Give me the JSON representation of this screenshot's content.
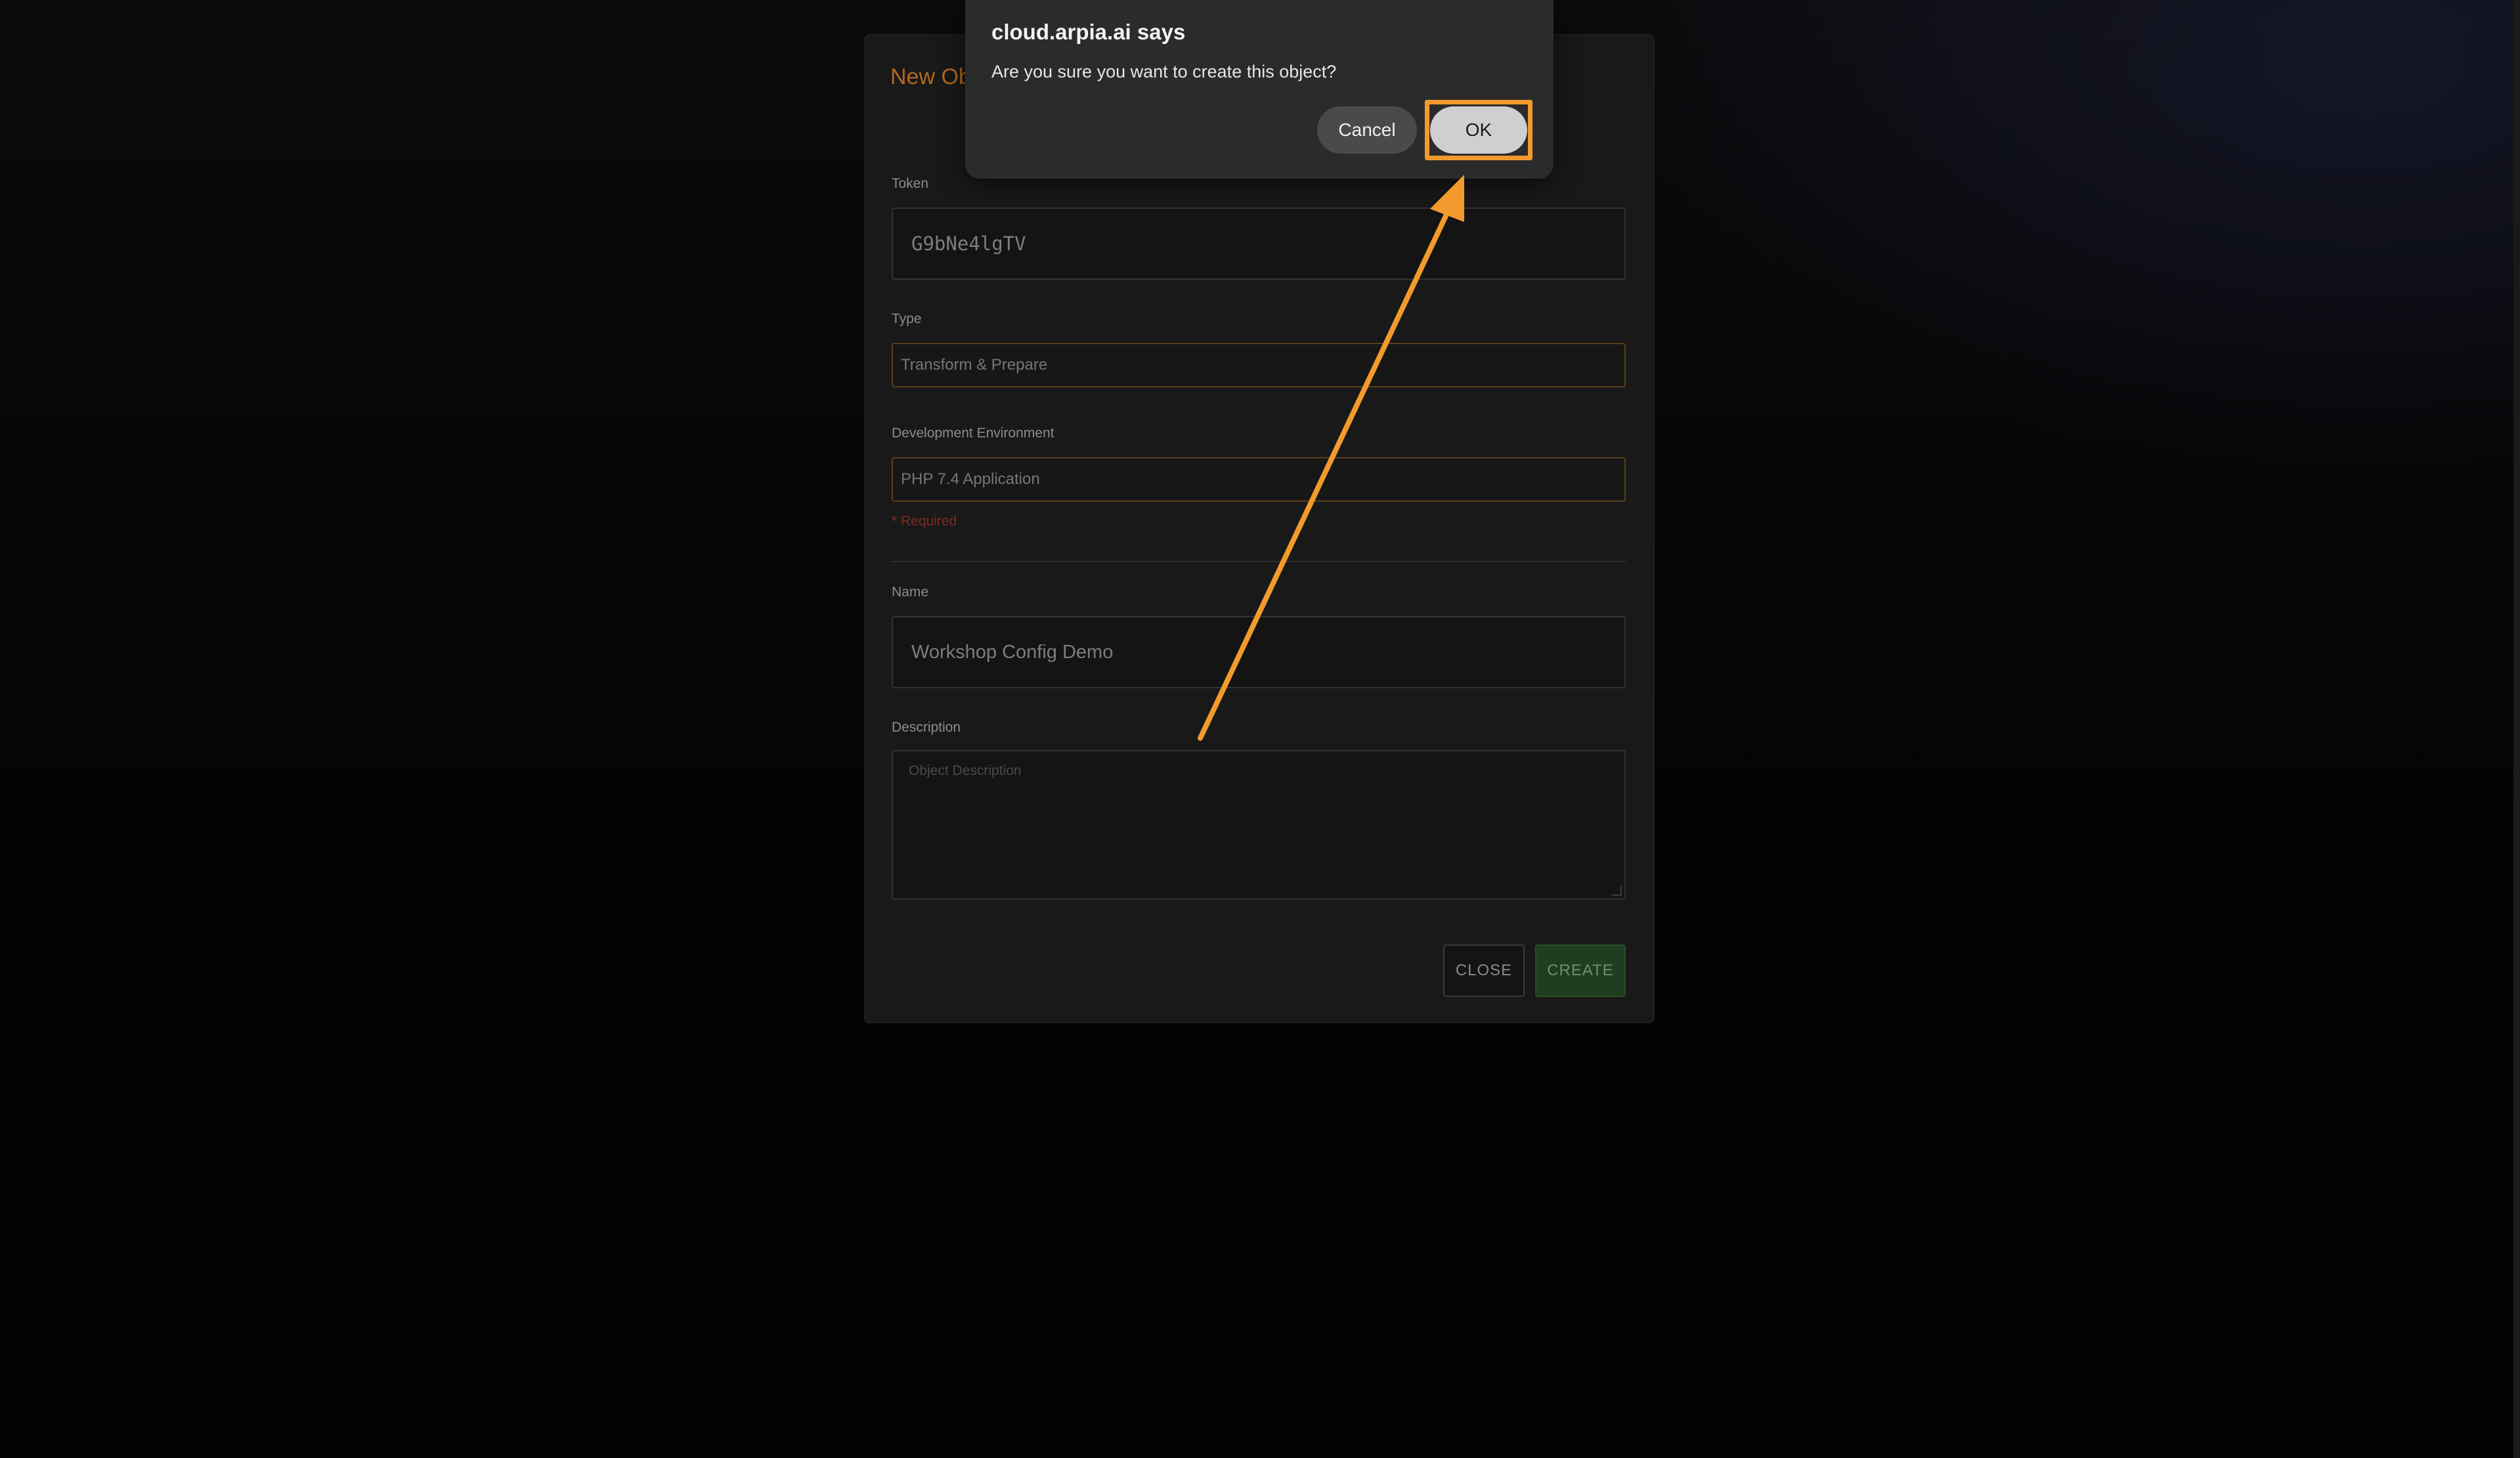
{
  "modal": {
    "title": "New Object",
    "token": {
      "label": "Token",
      "value": "G9bNe4lgTV"
    },
    "type": {
      "label": "Type",
      "value": "Transform & Prepare"
    },
    "environment": {
      "label": "Development Environment",
      "value": "PHP 7.4 Application",
      "required_note": "* Required"
    },
    "name": {
      "label": "Name",
      "value": "Workshop Config Demo"
    },
    "description": {
      "label": "Description",
      "placeholder": "Object Description"
    },
    "close_label": "CLOSE",
    "create_label": "CREATE"
  },
  "dialog": {
    "title": "cloud.arpia.ai says",
    "message": "Are you sure you want to create this object?",
    "cancel_label": "Cancel",
    "ok_label": "OK"
  },
  "colors": {
    "accent_orange": "#f29a2e",
    "title_orange": "#b5691f",
    "create_green": "#1f3d1f"
  }
}
